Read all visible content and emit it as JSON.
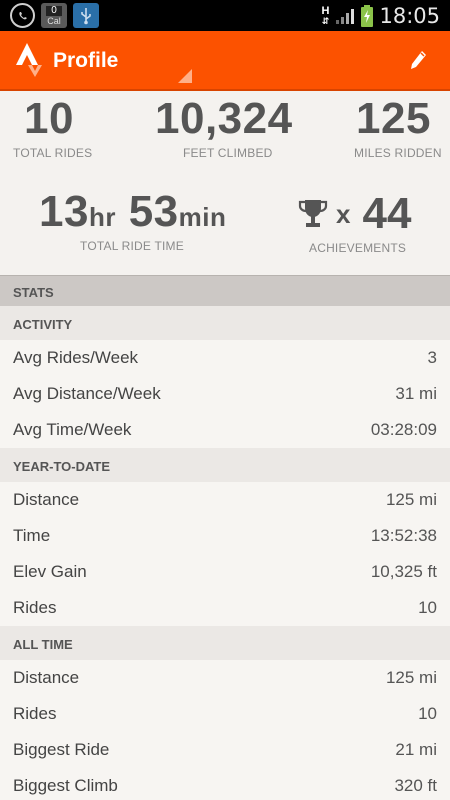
{
  "status_bar": {
    "calendar_day": "0",
    "calendar_label": "Cal",
    "network_type": "H",
    "time": "18:05"
  },
  "action_bar": {
    "title": "Profile",
    "logo_icon": "strava-logo-icon",
    "edit_icon": "pencil-icon",
    "brand_color": "#fc5200"
  },
  "summary": {
    "total_rides": {
      "value": "10",
      "label": "TOTAL RIDES"
    },
    "feet_climbed": {
      "value": "10,324",
      "label": "FEET CLIMBED"
    },
    "miles_ridden": {
      "value": "125",
      "label": "MILES RIDDEN"
    },
    "ride_time": {
      "hours": "13",
      "hours_unit": "hr",
      "minutes": "53",
      "minutes_unit": "min",
      "label": "TOTAL RIDE TIME"
    },
    "achievements": {
      "multiplier": "x",
      "value": "44",
      "label": "ACHIEVEMENTS"
    }
  },
  "stats": {
    "title": "STATS",
    "sections": [
      {
        "title": "ACTIVITY",
        "rows": [
          {
            "label": "Avg Rides/Week",
            "value": "3"
          },
          {
            "label": "Avg Distance/Week",
            "value": "31 mi"
          },
          {
            "label": "Avg Time/Week",
            "value": "03:28:09"
          }
        ]
      },
      {
        "title": "YEAR-TO-DATE",
        "rows": [
          {
            "label": "Distance",
            "value": "125 mi"
          },
          {
            "label": "Time",
            "value": "13:52:38"
          },
          {
            "label": "Elev Gain",
            "value": "10,325 ft"
          },
          {
            "label": "Rides",
            "value": "10"
          }
        ]
      },
      {
        "title": "ALL TIME",
        "rows": [
          {
            "label": "Distance",
            "value": "125 mi"
          },
          {
            "label": "Rides",
            "value": "10"
          },
          {
            "label": "Biggest Ride",
            "value": "21 mi"
          },
          {
            "label": "Biggest Climb",
            "value": "320 ft"
          }
        ]
      }
    ]
  }
}
